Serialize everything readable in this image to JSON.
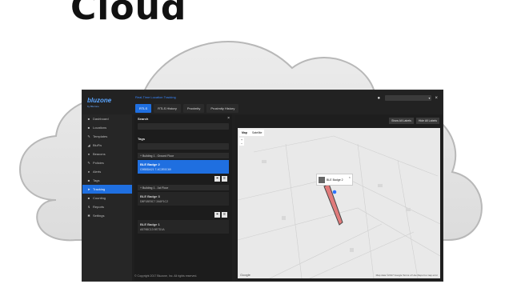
{
  "headline": "Cloud",
  "app": {
    "logo_text": "bluzone",
    "logo_sub": "by Bluzone",
    "title": "Real-Time Location Tracking",
    "tabs": [
      {
        "label": "RTLS",
        "active": true
      },
      {
        "label": "RTLS History",
        "active": false
      },
      {
        "label": "Proximity",
        "active": false
      },
      {
        "label": "Proximity History",
        "active": false
      }
    ],
    "close_glyph": "×"
  },
  "sidebar": {
    "items": [
      {
        "label": "Dashboard",
        "icon": "dashboard-icon",
        "glyph": "■",
        "active": false
      },
      {
        "label": "Locations",
        "icon": "locations-icon",
        "glyph": "■",
        "active": false
      },
      {
        "label": "Templates",
        "icon": "templates-icon",
        "glyph": "✎",
        "active": false
      },
      {
        "label": "BluFis",
        "icon": "blufis-icon",
        "glyph": "◢",
        "active": false
      },
      {
        "label": "Beacons",
        "icon": "beacons-icon",
        "glyph": "●",
        "active": false
      },
      {
        "label": "Policies",
        "icon": "policies-icon",
        "glyph": "✎",
        "active": false
      },
      {
        "label": "Alerts",
        "icon": "alerts-icon",
        "glyph": "●",
        "active": false
      },
      {
        "label": "Tags",
        "icon": "tags-icon",
        "glyph": "■",
        "active": false
      },
      {
        "label": "Tracking",
        "icon": "tracking-icon",
        "glyph": "➤",
        "active": true
      },
      {
        "label": "Counting",
        "icon": "counting-icon",
        "glyph": "■",
        "active": false
      },
      {
        "label": "Reports",
        "icon": "reports-icon",
        "glyph": "↯",
        "active": false
      },
      {
        "label": "Settings",
        "icon": "settings-icon",
        "glyph": "✱",
        "active": false
      }
    ]
  },
  "panel": {
    "search_label": "Search",
    "tags_label": "Tags",
    "close_glyph": "×",
    "group1": "+ Building 1 - Ground Floor",
    "card1_title": "BLE Badge 2",
    "card1_sub": "C9B5DA21 7-4C2E0C69",
    "group2": "+ Building 1 - 1st Floor",
    "card2_title": "BLE Badge 3",
    "card2_sub": "D8F18E5C7 2A6F1C2",
    "card3_title": "BLE Badge 1",
    "card3_sub": "A5798C13 9E7D1A",
    "copyright": "© Copyright 2017 Bluzone, Inc. All rights reserved."
  },
  "map": {
    "show_labels": "Show All Labels",
    "hide_labels": "Hide All Labels",
    "map_tab": "Map",
    "satellite_tab": "Satellite",
    "zoom_in": "+",
    "zoom_out": "−",
    "tooltip_title": "BLE Badge 2",
    "tooltip_close": "×",
    "google": "Google",
    "footer": "Map data ©2017 Google   Terms of Use   Report a map error"
  },
  "colors": {
    "accent": "#1f6fe0",
    "badge_fill": "#e07070",
    "badge_marker": "#2f74ff"
  }
}
